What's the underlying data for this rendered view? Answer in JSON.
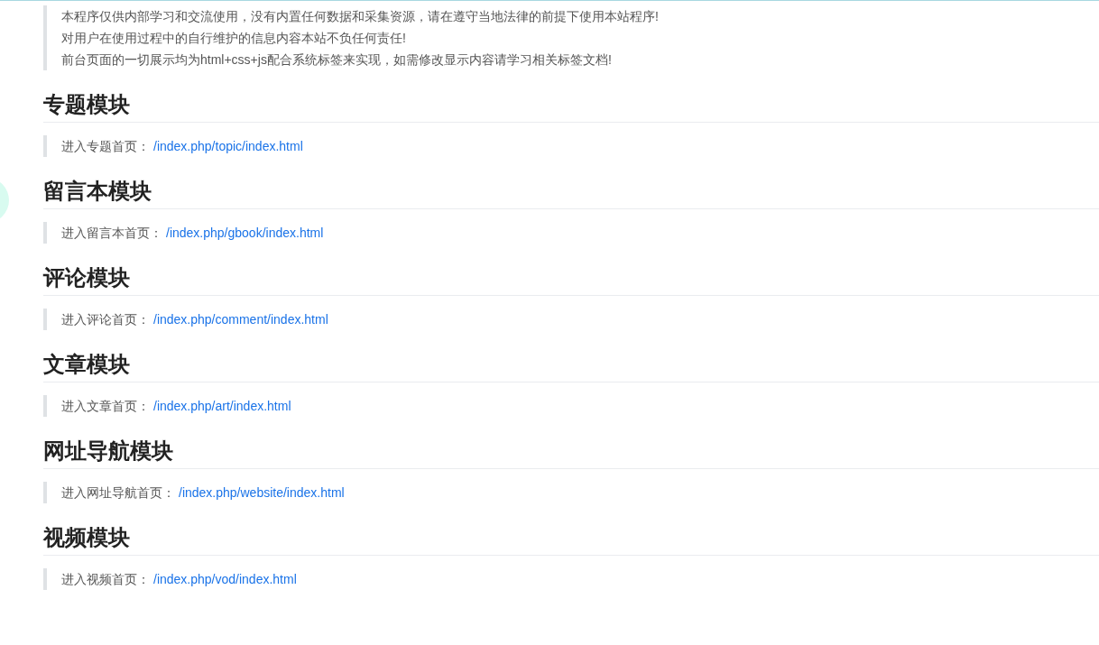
{
  "notice": [
    "本程序仅供内部学习和交流使用，没有内置任何数据和采集资源，请在遵守当地法律的前提下使用本站程序!",
    "对用户在使用过程中的自行维护的信息内容本站不负任何责任!",
    "前台页面的一切展示均为html+css+js配合系统标签来实现，如需修改显示内容请学习相关标签文档!"
  ],
  "sections": [
    {
      "title": "专题模块",
      "label": "进入专题首页：",
      "link": "/index.php/topic/index.html"
    },
    {
      "title": "留言本模块",
      "label": "进入留言本首页：",
      "link": "/index.php/gbook/index.html"
    },
    {
      "title": "评论模块",
      "label": "进入评论首页：",
      "link": "/index.php/comment/index.html"
    },
    {
      "title": "文章模块",
      "label": "进入文章首页：",
      "link": "/index.php/art/index.html"
    },
    {
      "title": "网址导航模块",
      "label": "进入网址导航首页：",
      "link": "/index.php/website/index.html"
    },
    {
      "title": "视频模块",
      "label": "进入视频首页：",
      "link": "/index.php/vod/index.html"
    }
  ]
}
